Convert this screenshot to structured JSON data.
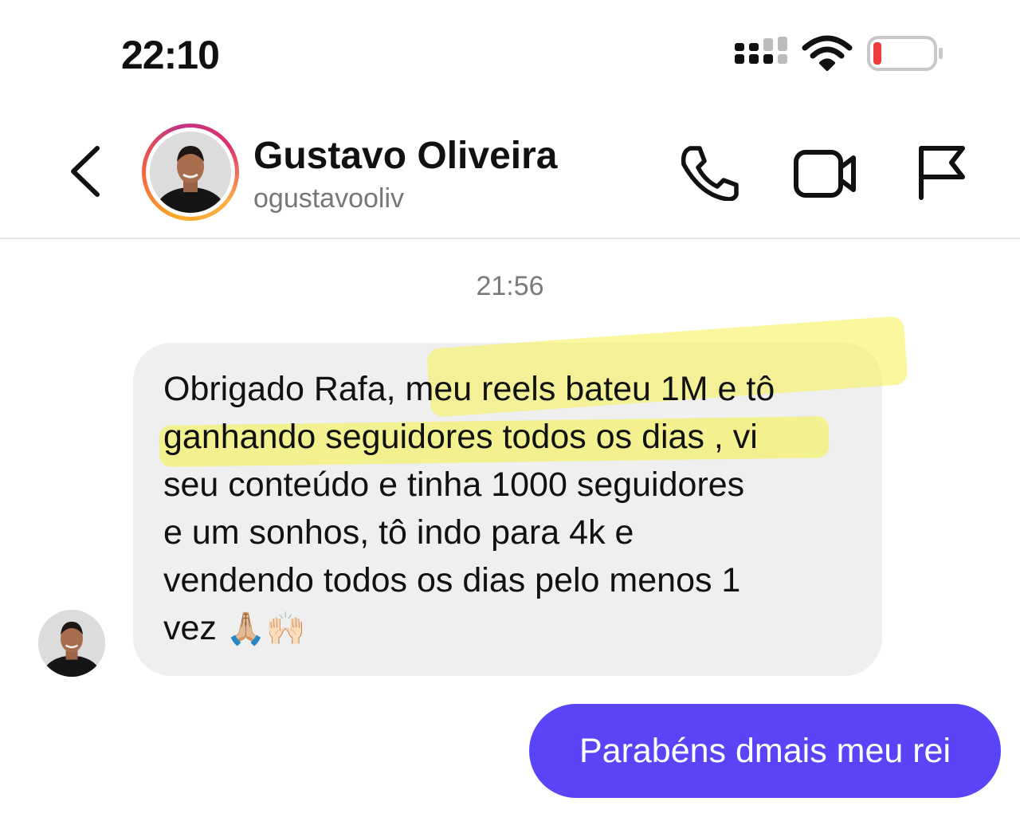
{
  "status_bar": {
    "time": "22:10",
    "battery_color": "#f23b3b"
  },
  "header": {
    "contact_name": "Gustavo Oliveira",
    "contact_handle": "ogustavooliv",
    "icons": [
      "back-icon",
      "phone-icon",
      "video-icon",
      "flag-icon"
    ]
  },
  "thread": {
    "timestamp": "21:56",
    "incoming": {
      "lines": [
        "Obrigado Rafa, meu reels bateu 1M e tô",
        "ganhando seguidores todos os dias , vi",
        "seu conteúdo e tinha 1000 seguidores",
        "e um sonhos, tô indo para 4k e",
        "vendendo todos os dias pelo menos 1",
        "vez"
      ],
      "emojis": "🙏🏼🙌🏻",
      "highlight_color": "#f5f050"
    },
    "outgoing": {
      "text": "Parabéns dmais meu rei",
      "bubble_color": "#5b44f7"
    }
  }
}
